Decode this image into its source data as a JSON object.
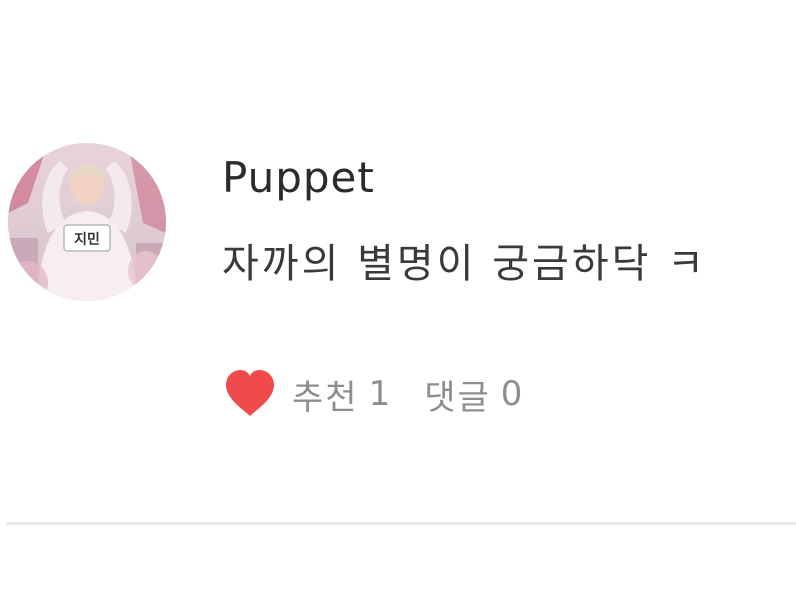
{
  "comment": {
    "avatar_icon": "profile-photo",
    "avatar_label": "지민",
    "username": "Puppet",
    "text": "자까의 별명이 궁금하닥 ㅋ",
    "recommend_icon": "heart-icon",
    "recommend_label": "추천",
    "recommend_count": "1",
    "reply_label": "댓글",
    "reply_count": "0",
    "colors": {
      "heart": "#ef4b4b",
      "meta_text": "#8e8e8e",
      "divider": "#e9e9e9"
    }
  }
}
